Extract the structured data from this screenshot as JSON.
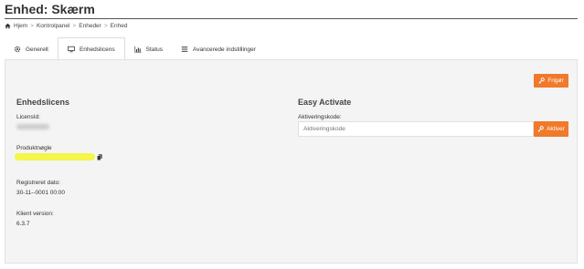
{
  "page": {
    "title": "Enhed: Skærm"
  },
  "breadcrumb": {
    "home": "Hjem",
    "control_panel": "Kontrolpanel",
    "devices": "Enheder",
    "device": "Enhed",
    "separator": ">"
  },
  "tabs": [
    {
      "label": "Generelt",
      "icon": "gear-icon"
    },
    {
      "label": "Enhedslicens",
      "icon": "monitor-icon",
      "active": true
    },
    {
      "label": "Status",
      "icon": "bar-chart-icon"
    },
    {
      "label": "Avancerede indstillinger",
      "icon": "list-icon"
    }
  ],
  "license": {
    "title": "Enhedslicens",
    "license_id_label": "LicensId:",
    "product_key_label": "Produktnøgle",
    "registered_label": "Registreret dato:",
    "registered_value": "30-11--0001 00:00",
    "client_version_label": "Klient version:",
    "client_version_value": "6.3.7"
  },
  "easy_activate": {
    "title": "Easy Activate",
    "code_label": "Aktiveringskode:",
    "code_placeholder": "Aktiveringskode",
    "activate_label": "Aktiver"
  },
  "actions": {
    "release_label": "Frigør"
  },
  "colors": {
    "accent": "#f0792b",
    "highlight": "#f5f54a",
    "panel_bg": "#f4f4f4"
  }
}
